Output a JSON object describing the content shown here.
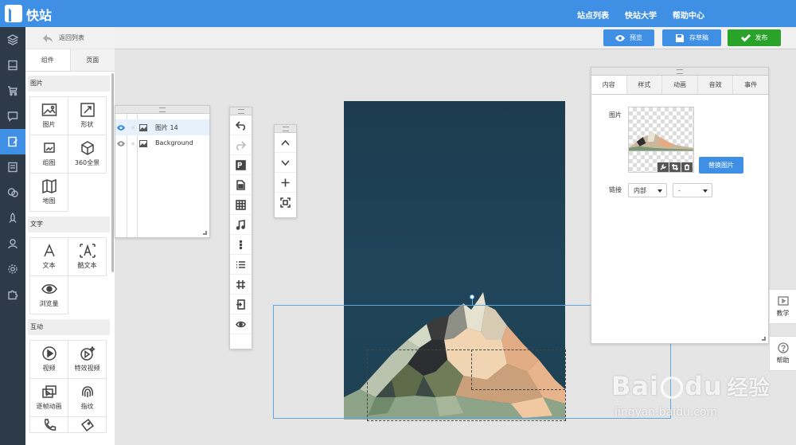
{
  "app": {
    "brand": "快站"
  },
  "topnav": [
    "站点列表",
    "快站大学",
    "帮助中心"
  ],
  "panel": {
    "back_label": "返回列表",
    "tabs": [
      "组件",
      "页面"
    ],
    "sections": {
      "image": {
        "title": "图片",
        "items": [
          "图片",
          "形状",
          "组图",
          "360全景",
          "地图"
        ]
      },
      "text": {
        "title": "文字",
        "items": [
          "文本",
          "酷文本",
          "浏览量"
        ]
      },
      "interact": {
        "title": "互动",
        "items": [
          "视频",
          "特效视频",
          "逐帧动画",
          "指纹"
        ]
      }
    }
  },
  "toolbar": {
    "preview": "预览",
    "save_draft": "存草稿",
    "publish": "发布"
  },
  "layers": [
    {
      "name": "图片 14",
      "selected": true
    },
    {
      "name": "Background",
      "selected": false
    }
  ],
  "props": {
    "tabs": [
      "内容",
      "样式",
      "动画",
      "音效",
      "事件"
    ],
    "image_label": "图片",
    "replace_button": "替换图片",
    "link_label": "链接",
    "link_type": "内部",
    "link_target": "-"
  },
  "side_help": {
    "tutorial": "教学",
    "help": "帮助"
  },
  "watermark": {
    "brand": "Bai",
    "brand2": "du",
    "cn": "经验",
    "url": "jingyan.baidu.com"
  },
  "colors": {
    "primary": "#3f8fe4",
    "publish": "#2aa32a",
    "rail": "#2d3a48",
    "stage": "#1c3b4e"
  }
}
